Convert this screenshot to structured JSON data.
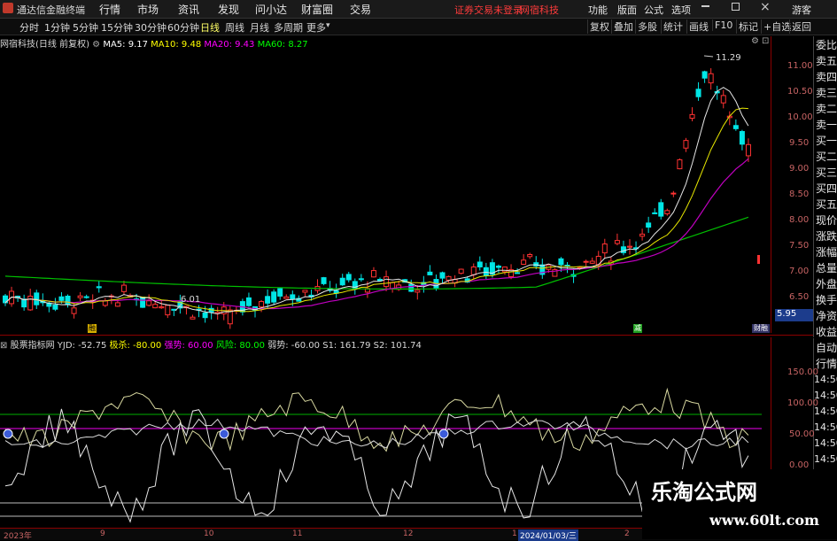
{
  "app": {
    "title": "通达信金融终端"
  },
  "top_menu": [
    "行情",
    "市场",
    "资讯",
    "发现",
    "问小达",
    "财富圈",
    "交易"
  ],
  "login_notice": "证券交易未登录",
  "security_name_red": "网宿科技",
  "right_menu": [
    "功能",
    "版面",
    "公式",
    "选项"
  ],
  "guest": "游客",
  "periods": [
    "分时",
    "1分钟",
    "5分钟",
    "15分钟",
    "30分钟",
    "60分钟",
    "日线",
    "周线",
    "月线",
    "多周期",
    "更多"
  ],
  "active_period": "日线",
  "chart_buttons": [
    "复权",
    "叠加",
    "多股",
    "统计",
    "画线",
    "F10",
    "标记",
    "+自选",
    "返回"
  ],
  "main_legend": {
    "title": "网宿科技(日线 前复权)",
    "ma5": "MA5: 9.17",
    "ma10": "MA10: 9.48",
    "ma20": "MA20: 9.43",
    "ma60": "MA60: 8.27"
  },
  "price_axis": [
    "11.00",
    "10.50",
    "10.00",
    "9.50",
    "9.00",
    "8.50",
    "8.00",
    "7.50",
    "7.00",
    "6.50"
  ],
  "current_price_tag": "5.95",
  "high_label": "11.29",
  "low_label": "6.01",
  "markers": {
    "left": "融",
    "mid": "减",
    "right": "财融"
  },
  "right_panel": [
    "委比",
    "卖五",
    "卖四",
    "卖三",
    "卖二",
    "卖一",
    "买一",
    "买二",
    "买三",
    "买四",
    "买五",
    "现价",
    "涨跌",
    "涨幅",
    "总量",
    "外盘",
    "换手",
    "净资",
    "收益"
  ],
  "right_panel_lower": [
    "自动",
    "行情",
    "14:50",
    "14:50",
    "14:50",
    "14:50",
    "14:50",
    "14:50"
  ],
  "indicator": {
    "name": "股票指标网",
    "yjd": "YJD: -52.75",
    "jisha": "极杀: -80.00",
    "qiangshi": "强势: 60.00",
    "fengxian": "风险: 80.00",
    "ruoshi": "弱势: -60.00",
    "s1": "S1: 161.79",
    "s2": "S2: 101.74"
  },
  "indicator_axis": [
    "150.00",
    "100.00",
    "50.00",
    "0.00"
  ],
  "date_axis": [
    "2023年",
    "9",
    "10",
    "11",
    "12",
    "1",
    "2024/01/03/三",
    "2"
  ],
  "watermark": {
    "line1": "乐淘公式网",
    "line2": "www.60lt.com"
  },
  "colors": {
    "up": "#ff3232",
    "down": "#00ffff",
    "ma5": "#ffffff",
    "ma10": "#ffff00",
    "ma20": "#ff00ff",
    "ma60": "#00ff00",
    "axis": "#c86464",
    "green_line": "#00c000",
    "magenta_line": "#ff00ff"
  }
}
